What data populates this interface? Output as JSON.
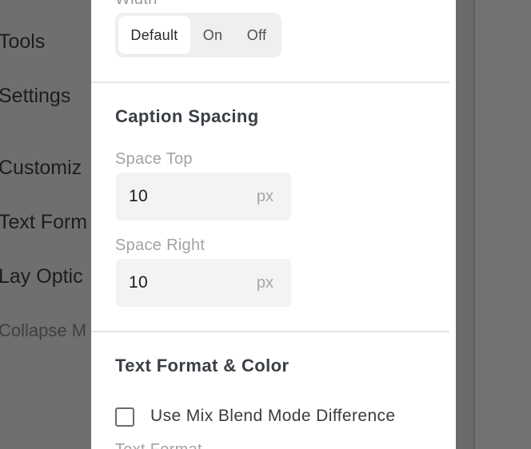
{
  "background_menu": {
    "items": [
      "Tools",
      "Settings",
      "Customiz",
      "Text Form",
      "Lay Optic",
      "Collapse M"
    ]
  },
  "panel": {
    "cut_top_label": "Width",
    "width_toggle": {
      "options": [
        "Default",
        "On",
        "Off"
      ],
      "selected": "Default"
    },
    "caption_spacing": {
      "title": "Caption Spacing",
      "space_top": {
        "label": "Space Top",
        "value": "10",
        "unit": "px"
      },
      "space_right": {
        "label": "Space Right",
        "value": "10",
        "unit": "px"
      }
    },
    "text_format": {
      "title": "Text Format & Color",
      "mix_blend": {
        "label": "Use Mix Blend Mode Difference",
        "checked": false
      },
      "cut_bottom_label": "Text Format"
    }
  },
  "colors": {
    "overlay": "#6e6e6e",
    "panel_bg": "#ffffff",
    "field_bg": "#f3f3f3",
    "title_text": "#3a3f46"
  }
}
